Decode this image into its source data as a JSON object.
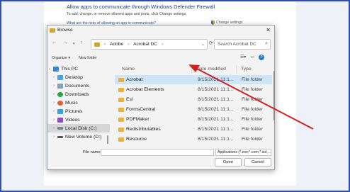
{
  "firewall": {
    "title": "Allow apps to communicate through Windows Defender Firewall",
    "description": "To add, change, or remove allowed apps and ports, click Change settings.",
    "risk_link": "What are the risks of allowing an app to communicate?",
    "change_settings": "Change settings"
  },
  "dialog": {
    "title": "Browse",
    "close": "✕",
    "nav": {
      "back": "←",
      "forward": "→",
      "up": "↑",
      "refresh": "⟳"
    },
    "breadcrumb": [
      "Adobe",
      "Acrobat DC"
    ],
    "search_placeholder": "Search Acrobat DC",
    "toolbar": {
      "organize": "Organize ▾",
      "new_folder": "New folder"
    },
    "sidebar": [
      {
        "label": "This PC",
        "icon": "computer-icon",
        "expanded": true
      },
      {
        "label": "Desktop",
        "icon": "desktop-icon"
      },
      {
        "label": "Documents",
        "icon": "documents-icon"
      },
      {
        "label": "Downloads",
        "icon": "downloads-icon"
      },
      {
        "label": "Music",
        "icon": "music-icon"
      },
      {
        "label": "Pictures",
        "icon": "pictures-icon"
      },
      {
        "label": "Videos",
        "icon": "videos-icon"
      },
      {
        "label": "Local Disk (C:)",
        "icon": "drive-icon",
        "selected": true
      },
      {
        "label": "New Volume (D:)",
        "icon": "drive-icon"
      }
    ],
    "columns": {
      "name": "Name",
      "date": "Date modified",
      "type": "Type"
    },
    "files": [
      {
        "name": "Acrobat",
        "date": "8/15/2021 11:1...",
        "type": "File folder",
        "selected": true
      },
      {
        "name": "Acrobat Elements",
        "date": "8/15/2021 11:1...",
        "type": "File folder"
      },
      {
        "name": "Esl",
        "date": "8/15/2021 11:1...",
        "type": "File folder"
      },
      {
        "name": "FormsCentral",
        "date": "8/15/2021 11:1...",
        "type": "File folder"
      },
      {
        "name": "PDFMaker",
        "date": "8/15/2021 11:1...",
        "type": "File folder"
      },
      {
        "name": "Redistributables",
        "date": "8/15/2021 11:1...",
        "type": "File folder"
      },
      {
        "name": "Resource",
        "date": "8/15/2021 11:1...",
        "type": "File folder"
      }
    ],
    "file_name_label": "File name:",
    "file_name_value": "",
    "file_type": "Applications (*.exe;*.com;*.icd;...",
    "open_label": "Open",
    "cancel_label": "Cancel"
  },
  "colors": {
    "accent": "#2b4db8",
    "selection": "#cfe4f7",
    "folder": "#e8b33a",
    "annotation_arrow": "#d62020"
  }
}
